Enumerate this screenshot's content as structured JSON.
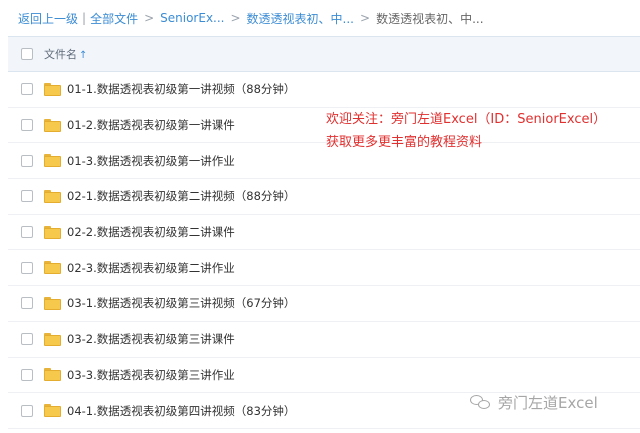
{
  "breadcrumb": {
    "back": "返回上一级",
    "all_files": "全部文件",
    "crumb1": "SeniorEx...",
    "crumb2": "数透透视表初、中...",
    "current": "数透透视表初、中..."
  },
  "list_header": {
    "name_label": "文件名",
    "sort_arrow": "↑"
  },
  "files": [
    "01-1.数据透视表初级第一讲视频（88分钟）",
    "01-2.数据透视表初级第一讲课件",
    "01-3.数据透视表初级第一讲作业",
    "02-1.数据透视表初级第二讲视频（88分钟）",
    "02-2.数据透视表初级第二讲课件",
    "02-3.数据透视表初级第二讲作业",
    "03-1.数据透视表初级第三讲视频（67分钟）",
    "03-2.数据透视表初级第三讲课件",
    "03-3.数据透视表初级第三讲作业",
    "04-1.数据透视表初级第四讲视频（83分钟）"
  ],
  "promo": {
    "line1": "欢迎关注：旁门左道Excel（ID：SeniorExcel）",
    "line2": "获取更多更丰富的教程资料"
  },
  "watermark": {
    "icon": "wechat-icon",
    "text": "旁门左道Excel"
  },
  "colors": {
    "link": "#3b8cd4",
    "promo": "#e0302f",
    "folder": "#f6c94d",
    "header_bg": "#f2f6fb"
  }
}
